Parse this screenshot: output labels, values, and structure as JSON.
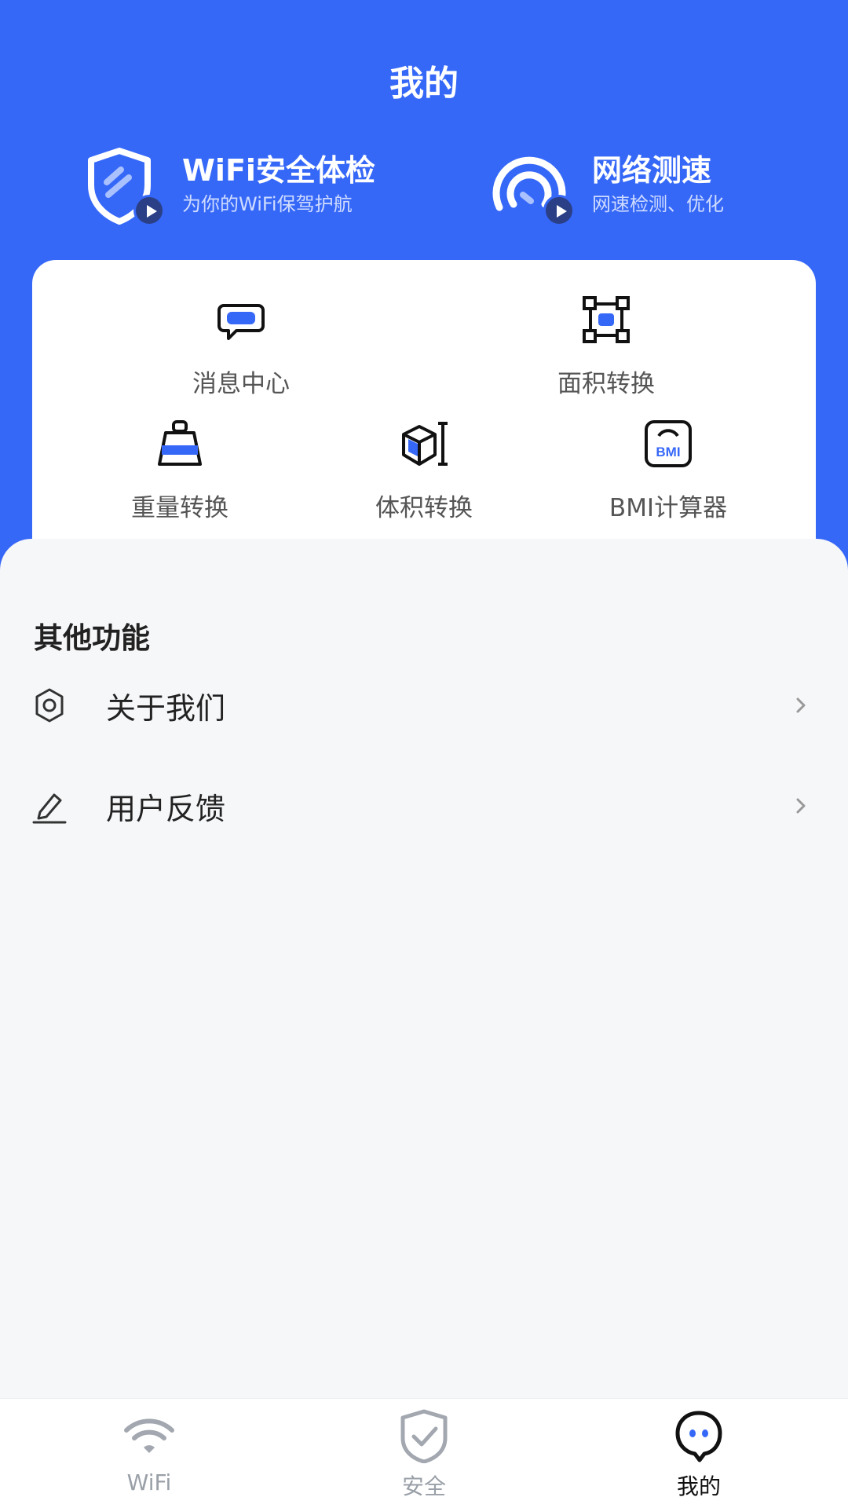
{
  "header": {
    "title": "我的"
  },
  "features": [
    {
      "title": "WiFi安全体检",
      "subtitle": "为你的WiFi保驾护航",
      "icon": "shield-icon"
    },
    {
      "title": "网络测速",
      "subtitle": "网速检测、优化",
      "icon": "speedometer-icon"
    }
  ],
  "tools": [
    {
      "label": "消息中心",
      "icon": "message-icon"
    },
    {
      "label": "面积转换",
      "icon": "area-icon"
    },
    {
      "label": "重量转换",
      "icon": "weight-icon"
    },
    {
      "label": "体积转换",
      "icon": "volume-icon"
    },
    {
      "label": "BMI计算器",
      "icon": "bmi-icon",
      "icon_text": "BMI"
    }
  ],
  "other": {
    "title": "其他功能",
    "items": [
      {
        "label": "关于我们",
        "icon": "gear-icon"
      },
      {
        "label": "用户反馈",
        "icon": "pencil-icon"
      }
    ]
  },
  "tabbar": {
    "tabs": [
      {
        "label": "WiFi",
        "icon": "wifi-icon",
        "active": false
      },
      {
        "label": "安全",
        "icon": "shield-check-icon",
        "active": false
      },
      {
        "label": "我的",
        "icon": "profile-icon",
        "active": true
      }
    ]
  },
  "colors": {
    "primary": "#3668f8",
    "background": "#f6f7f9"
  }
}
